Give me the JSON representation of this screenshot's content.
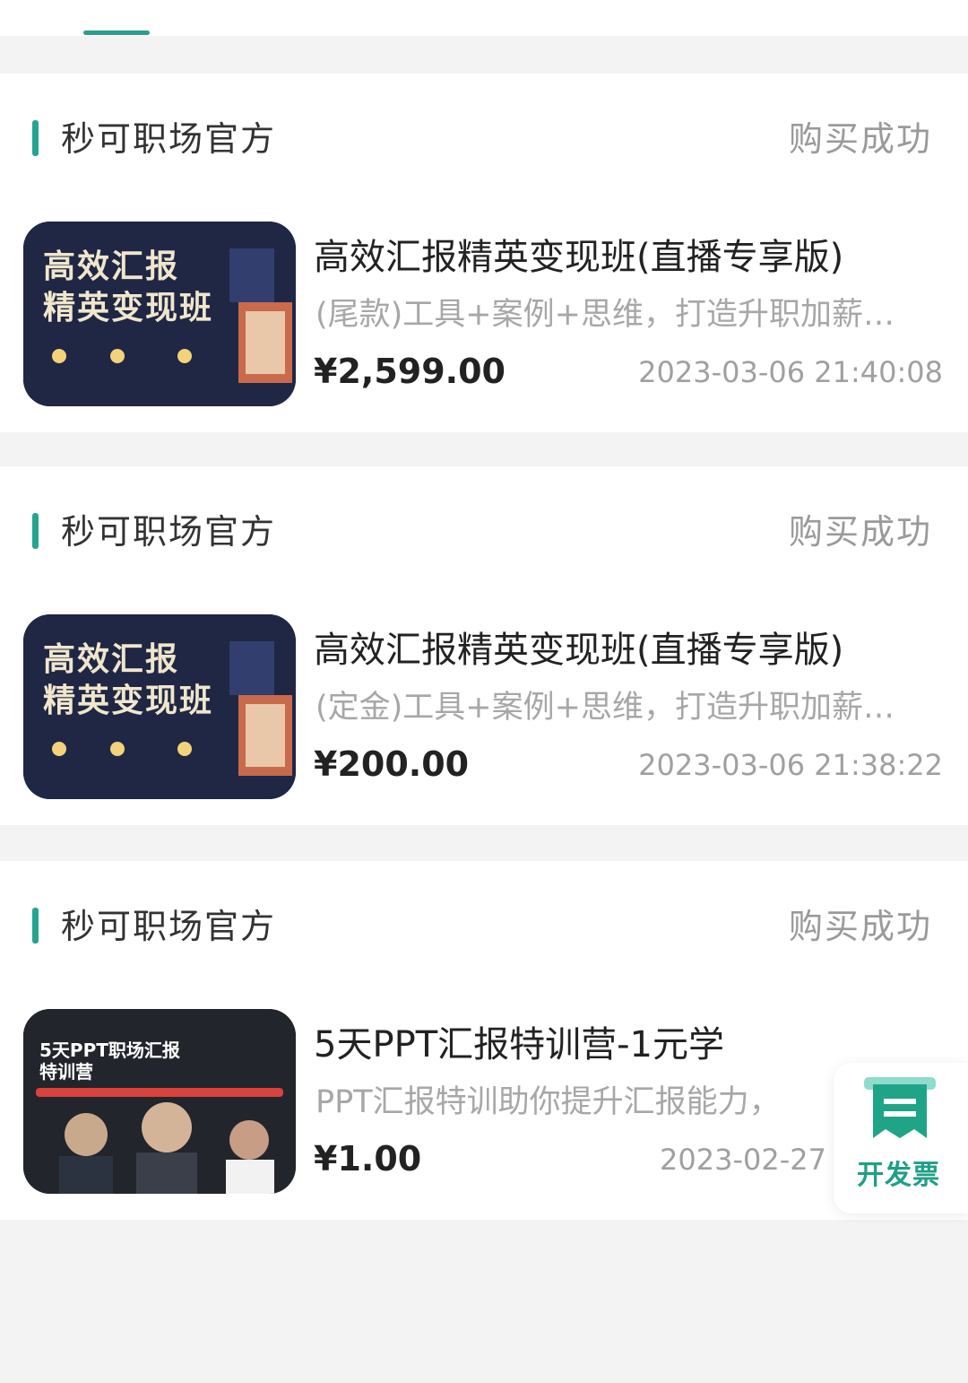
{
  "orders": [
    {
      "shop_name": "秒可职场官方",
      "status": "购买成功",
      "thumb_text": "高效汇报\n精英变现班",
      "title": "高效汇报精英变现班(直播专享版)",
      "description": "(尾款)工具+案例+思维，打造升职加薪…",
      "price": "¥2,599.00",
      "time": "2023-03-06 21:40:08"
    },
    {
      "shop_name": "秒可职场官方",
      "status": "购买成功",
      "thumb_text": "高效汇报\n精英变现班",
      "title": "高效汇报精英变现班(直播专享版)",
      "description": "(定金)工具+案例+思维，打造升职加薪…",
      "price": "¥200.00",
      "time": "2023-03-06 21:38:22"
    },
    {
      "shop_name": "秒可职场官方",
      "status": "购买成功",
      "thumb_text": "5天PPT职场汇报\n特训营",
      "title": "5天PPT汇报特训营-1元学",
      "description": "PPT汇报特训助你提升汇报能力，",
      "price": "¥1.00",
      "time": "2023-02-27"
    }
  ],
  "invoice": {
    "label": "开发票",
    "icon": "receipt-icon"
  },
  "colors": {
    "accent": "#25a48f",
    "status_text": "#9a9a9a",
    "page_bg": "#f3f3f3"
  }
}
